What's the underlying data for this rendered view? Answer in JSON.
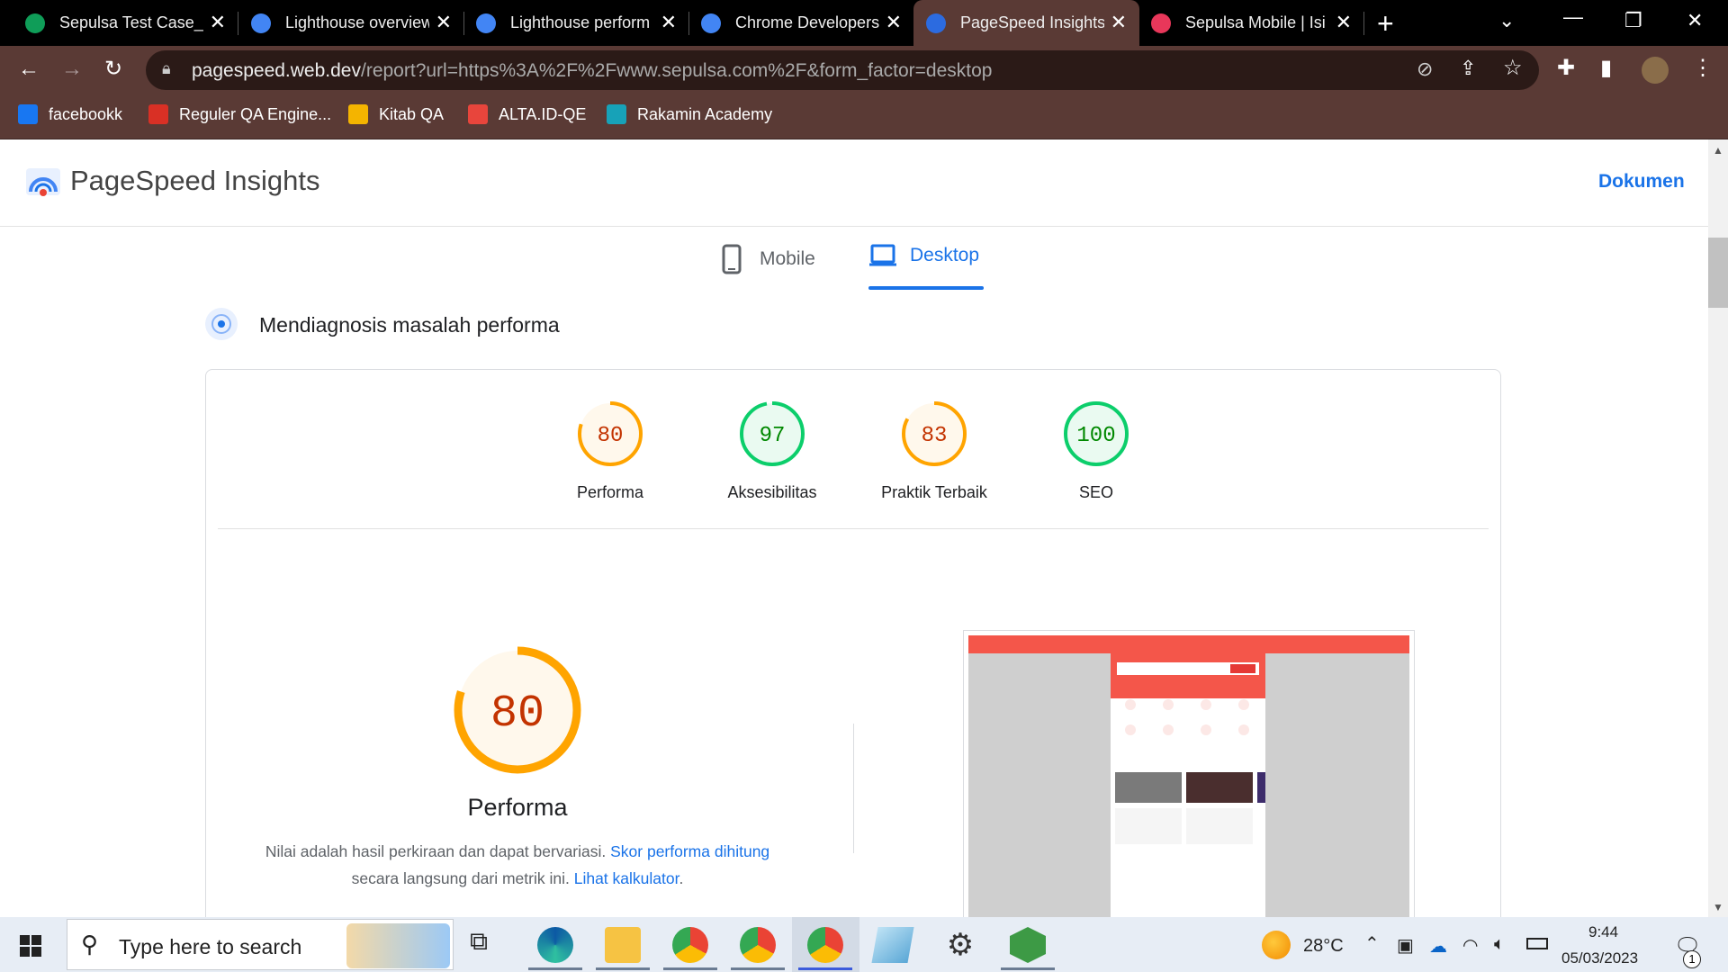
{
  "browser": {
    "tabs": [
      {
        "title": "Sepulsa Test Case_E",
        "color": "#0f9d58"
      },
      {
        "title": "Lighthouse overview",
        "color": "#4285f4"
      },
      {
        "title": "Lighthouse perform",
        "color": "#4285f4"
      },
      {
        "title": "Chrome Developers",
        "color": "#4285f4"
      },
      {
        "title": "PageSpeed Insights",
        "color": "#2c6be0",
        "active": true
      },
      {
        "title": "Sepulsa Mobile | Isi",
        "color": "#e8375a"
      }
    ],
    "url_host": "pagespeed.web.dev",
    "url_path": "/report?url=https%3A%2F%2Fwww.sepulsa.com%2F&form_factor=desktop",
    "bookmarks": [
      {
        "label": "facebookk",
        "color": "#1877f2"
      },
      {
        "label": "Reguler QA Engine...",
        "color": "#d93025"
      },
      {
        "label": "Kitab QA",
        "color": "#f4b400"
      },
      {
        "label": "ALTA.ID-QE",
        "color": "#e8453c"
      },
      {
        "label": "Rakamin Academy",
        "color": "#17a2b8"
      }
    ]
  },
  "page": {
    "brand": "PageSpeed Insights",
    "docs_link": "Dokumen",
    "device_tabs": {
      "mobile": "Mobile",
      "desktop": "Desktop"
    },
    "section_title": "Mendiagnosis masalah performa",
    "scores": [
      {
        "label": "Performa",
        "value": "80",
        "score": 80,
        "status": "average"
      },
      {
        "label": "Aksesibilitas",
        "value": "97",
        "score": 97,
        "status": "pass"
      },
      {
        "label": "Praktik Terbaik",
        "value": "83",
        "score": 83,
        "status": "average"
      },
      {
        "label": "SEO",
        "value": "100",
        "score": 100,
        "status": "pass"
      }
    ],
    "main_score": {
      "value": "80",
      "score": 80,
      "label": "Performa"
    },
    "desc_text_1": "Nilai adalah hasil perkiraan dan dapat bervariasi.",
    "desc_link_1": "Skor performa dihitung",
    "desc_text_2": "secara langsung dari metrik ini.",
    "desc_link_2": "Lihat kalkulator",
    "desc_end": ".",
    "colors": {
      "pass": "#0cce6b",
      "average": "#ffa400",
      "average_text": "#c33300",
      "pass_text": "#008800",
      "link": "#1a73e8"
    }
  },
  "taskbar": {
    "search_placeholder": "Type here to search",
    "temperature": "28°C",
    "time": "9:44",
    "date": "05/03/2023",
    "notification_count": "1"
  }
}
